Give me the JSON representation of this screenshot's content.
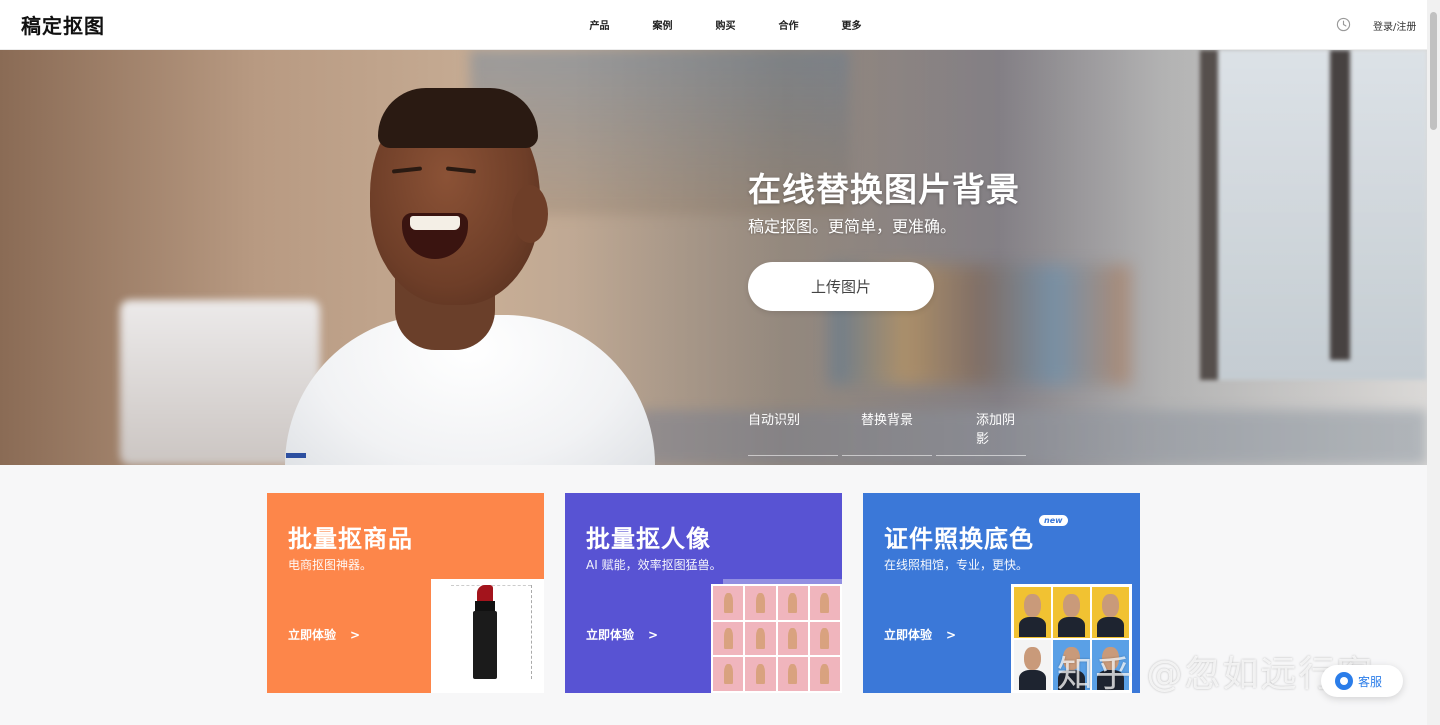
{
  "header": {
    "logo": "稿定抠图",
    "nav": [
      "产品",
      "案例",
      "购买",
      "合作",
      "更多"
    ],
    "login": "登录/注册"
  },
  "hero": {
    "title": "在线替换图片背景",
    "subtitle": "稿定抠图。更简单，更准确。",
    "upload_label": "上传图片",
    "features": [
      "自动识别",
      "替换背景",
      "添加阴影"
    ]
  },
  "cards": [
    {
      "title": "批量抠商品",
      "desc": "电商抠图神器。",
      "cta": "立即体验",
      "arrow": ">",
      "color": "#fd864a"
    },
    {
      "title": "批量抠人像",
      "desc": "AI 赋能，效率抠图猛兽。",
      "cta": "立即体验",
      "arrow": ">",
      "color": "#5853d3"
    },
    {
      "title": "证件照换底色",
      "desc": "在线照相馆，专业，更快。",
      "cta": "立即体验",
      "arrow": ">",
      "badge": "new",
      "color": "#3b78d8"
    }
  ],
  "id_photo_backgrounds": [
    "#f1c232",
    "#f1c232",
    "#f1c232",
    "#f4f4f4",
    "#5aa0e6",
    "#5aa0e6"
  ],
  "watermark": "知乎 @忽如远行客",
  "service": {
    "label": "客服",
    "icon": "chat-icon"
  }
}
